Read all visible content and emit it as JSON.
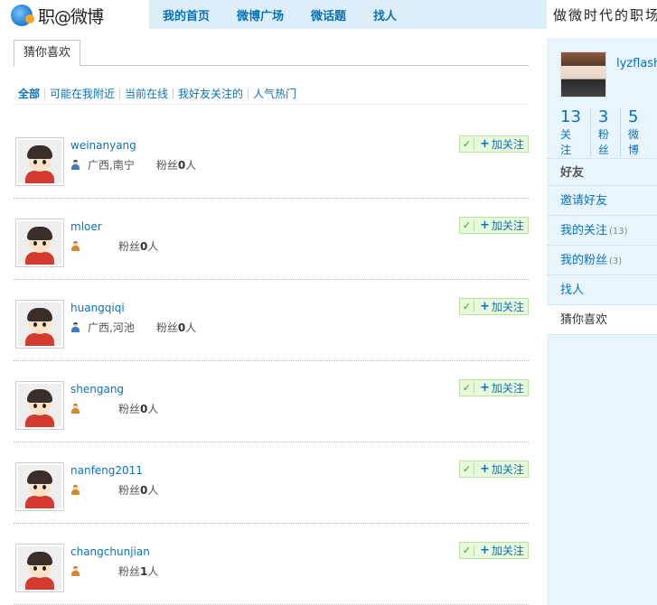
{
  "header": {
    "logo_text": "职@微博",
    "nav": [
      "我的首页",
      "微博广场",
      "微话题",
      "找人"
    ],
    "slogan": "做微时代的职场"
  },
  "tabs": [
    "猜你喜欢"
  ],
  "filters": [
    "全部",
    "可能在我附近",
    "当前在线",
    "我好友关注的",
    "人气热门"
  ],
  "fans_prefix": "粉丝",
  "fans_suffix": "人",
  "follow_label": "加关注",
  "follow_check": "✓",
  "users": [
    {
      "name": "weinanyang",
      "gender": "male",
      "location": "广西,南宁",
      "fans": "0"
    },
    {
      "name": "mloer",
      "gender": "female",
      "location": "",
      "fans": "0"
    },
    {
      "name": "huangqiqi",
      "gender": "male",
      "location": "广西,河池",
      "fans": "0"
    },
    {
      "name": "shengang",
      "gender": "female",
      "location": "",
      "fans": "0"
    },
    {
      "name": "nanfeng2011",
      "gender": "female",
      "location": "",
      "fans": "0"
    },
    {
      "name": "changchunjian",
      "gender": "female",
      "location": "",
      "fans": "1"
    }
  ],
  "sidebar": {
    "username": "lyzflash",
    "stats": [
      {
        "num": "13",
        "label": "关注"
      },
      {
        "num": "3",
        "label": "粉丝"
      },
      {
        "num": "5",
        "label": "微博"
      }
    ],
    "menu_head": "好友",
    "menu": [
      {
        "label": "邀请好友",
        "count": ""
      },
      {
        "label": "我的关注",
        "count": "(13)"
      },
      {
        "label": "我的粉丝",
        "count": "(3)"
      },
      {
        "label": "找人",
        "count": ""
      },
      {
        "label": "猜你喜欢",
        "count": "",
        "active": true
      }
    ]
  }
}
